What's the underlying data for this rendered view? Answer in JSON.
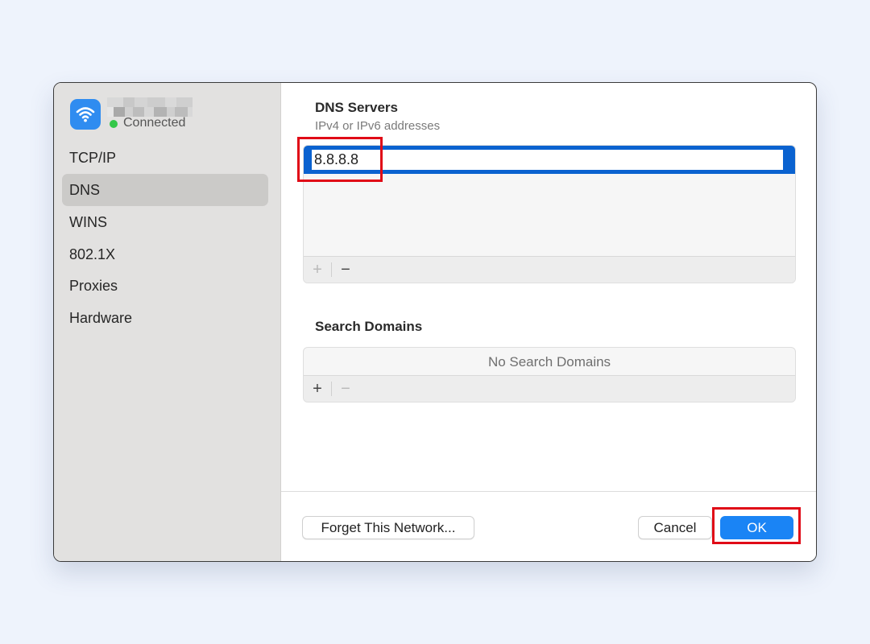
{
  "network": {
    "status": "Connected",
    "icon": "wifi-icon",
    "status_color": "#33c748"
  },
  "sidebar": {
    "items": [
      {
        "label": "TCP/IP"
      },
      {
        "label": "DNS",
        "active": true
      },
      {
        "label": "WINS"
      },
      {
        "label": "802.1X"
      },
      {
        "label": "Proxies"
      },
      {
        "label": "Hardware"
      }
    ]
  },
  "dns": {
    "title": "DNS Servers",
    "subtitle": "IPv4 or IPv6 addresses",
    "servers": [
      "8.8.8.8"
    ],
    "add_label": "+",
    "remove_label": "−"
  },
  "search_domains": {
    "title": "Search Domains",
    "empty_text": "No Search Domains",
    "add_label": "+",
    "remove_label": "−"
  },
  "footer": {
    "forget_label": "Forget This Network...",
    "cancel_label": "Cancel",
    "ok_label": "OK"
  },
  "colors": {
    "accent": "#1a84f5",
    "selection": "#0a62d0",
    "highlight": "#e00b17"
  }
}
